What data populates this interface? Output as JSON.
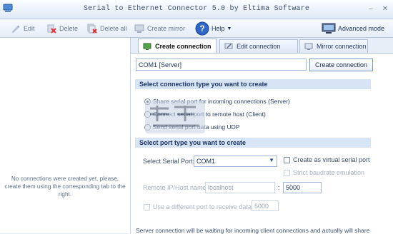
{
  "window": {
    "title": "Serial to Ethernet Connector 5.0 by Eltima Software",
    "minimize": "–",
    "close": "✕"
  },
  "toolbar": {
    "edit": "Edit",
    "delete": "Delete",
    "delete_all": "Delete all",
    "create_mirror": "Create mirror",
    "help": "Help",
    "advanced_mode": "Advanced mode"
  },
  "left": {
    "empty_message": "No connections were created yet, please, create them using the corresponding tab to the right."
  },
  "tabs": [
    {
      "label": "Create connection"
    },
    {
      "label": "Edit connection"
    },
    {
      "label": "Mirror connection"
    }
  ],
  "create": {
    "name_value": "COM1 [Server]",
    "create_button": "Create connection",
    "section1": "Select connection type you want to create",
    "radio_share": "Share serial port for incoming connections (Server)",
    "radio_connect": "Connect serial port to remote host (Client)",
    "radio_udp": "Send serial port data using UDP",
    "section2": "Select port type you want to create",
    "serial_port_label": "Select Serial Port:",
    "serial_port_value": "COM1",
    "virtual_port_label": "Create as virtual serial port",
    "strict_baud_label": "Strict baudrate emulation",
    "remote_host_label": "Remote IP/Host name:",
    "remote_host_value": "localhost",
    "port_separator": ":",
    "port_value": "5000",
    "different_port_label": "Use a different port to receive data:",
    "different_port_value": "5000",
    "footer": "Server connection will be waiting for incoming client connections and actually will share"
  }
}
